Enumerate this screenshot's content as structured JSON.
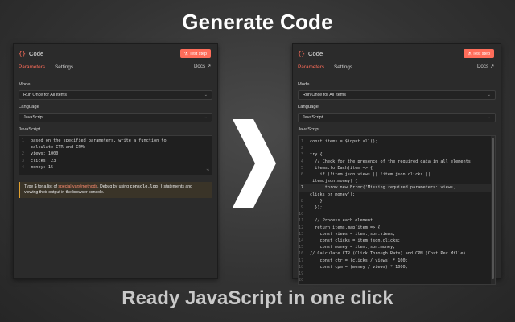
{
  "headline_top": "Generate Code",
  "headline_bottom": "Ready JavaScript in one click",
  "colors": {
    "accent": "#ff6d5a",
    "warning": "#e0a030"
  },
  "left_panel": {
    "title_icon": "{}",
    "title": "Code",
    "test_button": "Test step",
    "tabs": [
      "Parameters",
      "Settings"
    ],
    "docs": "Docs",
    "mode_label": "Mode",
    "mode_value": "Run Once for All Items",
    "language_label": "Language",
    "language_value": "JavaScript",
    "js_label": "JavaScript",
    "code_lines": [
      {
        "n": "1",
        "t": "based on the specified parameters, write a function to"
      },
      {
        "n": "",
        "t": "calculate CTR and CPM:"
      },
      {
        "n": "2",
        "t": "views: 1000"
      },
      {
        "n": "3",
        "t": "clicks: 23"
      },
      {
        "n": "4",
        "t": "money: 15"
      }
    ],
    "notice": {
      "p1": "Type $ for a list of ",
      "link": "special vars/methods",
      "p2": ". Debug by using ",
      "mono": "console.log()",
      "p3": " statements and",
      "p4": "viewing their output in the browser console."
    }
  },
  "right_panel": {
    "title_icon": "{}",
    "title": "Code",
    "test_button": "Test step",
    "tabs": [
      "Parameters",
      "Settings"
    ],
    "docs": "Docs",
    "mode_label": "Mode",
    "mode_value": "Run Once for All Items",
    "language_label": "Language",
    "language_value": "JavaScript",
    "js_label": "JavaScript",
    "code_lines": [
      {
        "n": "1",
        "t": "const items = $input.all();"
      },
      {
        "n": "2",
        "t": ""
      },
      {
        "n": "3",
        "t": "try {"
      },
      {
        "n": "4",
        "t": "  // Check for the presence of the required data in all elements"
      },
      {
        "n": "5",
        "t": "  items.forEach(item => {"
      },
      {
        "n": "6",
        "t": "    if (!item.json.views || !item.json.clicks ||"
      },
      {
        "n": "",
        "t": "!item.json.money) {"
      },
      {
        "n": "7",
        "t": "      throw new Error('Missing required parameters: views,"
      },
      {
        "n": "",
        "t": "clicks or money');"
      },
      {
        "n": "8",
        "t": "    }"
      },
      {
        "n": "9",
        "t": "  });"
      },
      {
        "n": "10",
        "t": ""
      },
      {
        "n": "11",
        "t": "  // Process each element"
      },
      {
        "n": "12",
        "t": "  return items.map(item => {"
      },
      {
        "n": "13",
        "t": "    const views = item.json.views;"
      },
      {
        "n": "14",
        "t": "    const clicks = item.json.clicks;"
      },
      {
        "n": "15",
        "t": "    const money = item.json.money;"
      },
      {
        "n": "16",
        "t": "// Calculate CTR (Click Through Rate) and CPM (Cost Per Mille)"
      },
      {
        "n": "17",
        "t": "    const ctr = (clicks / views) * 100;"
      },
      {
        "n": "18",
        "t": "    const cpm = (money / views) * 1000;"
      },
      {
        "n": "19",
        "t": ""
      },
      {
        "n": "20",
        "t": ""
      }
    ]
  }
}
